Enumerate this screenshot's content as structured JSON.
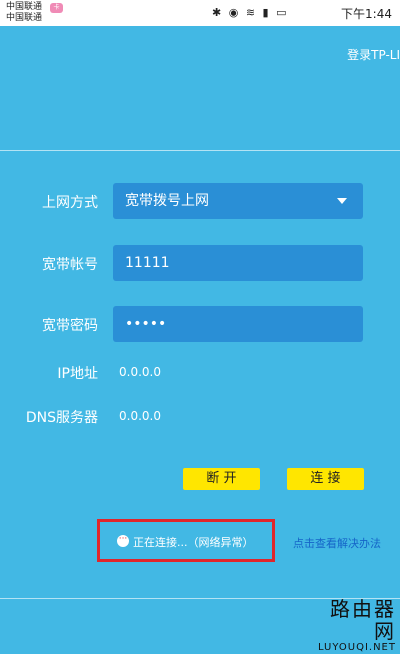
{
  "status_bar": {
    "carrier_1": "中国联通",
    "carrier_2": "中国联通",
    "carrier_badge": "卡",
    "icons": [
      "bluetooth-icon",
      "eye-icon",
      "wifi-icon",
      "signal-icon",
      "battery-icon"
    ],
    "time": "下午1:44"
  },
  "header": {
    "title": "登录TP-LI"
  },
  "form": {
    "connection_type": {
      "label": "上网方式",
      "value": "宽带拨号上网"
    },
    "account": {
      "label": "宽带帐号",
      "value": "11111"
    },
    "password": {
      "label": "宽带密码",
      "value": "•••••"
    },
    "ip": {
      "label": "IP地址",
      "value": "0.0.0.0"
    },
    "dns": {
      "label": "DNS服务器",
      "value": "0.0.0.0"
    }
  },
  "actions": {
    "disconnect_label": "断 开",
    "connect_label": "连 接"
  },
  "status": {
    "text": "正在连接...（网络异常）",
    "help_link": "点击查看解决办法"
  },
  "watermark": {
    "line1": "路由器网",
    "line2": "LUYOUQI.NET"
  },
  "colors": {
    "background": "#42b8e4",
    "field": "#2a8fd6",
    "button": "#ffe600",
    "highlight_border": "#e0262b",
    "link": "#1565c8"
  }
}
